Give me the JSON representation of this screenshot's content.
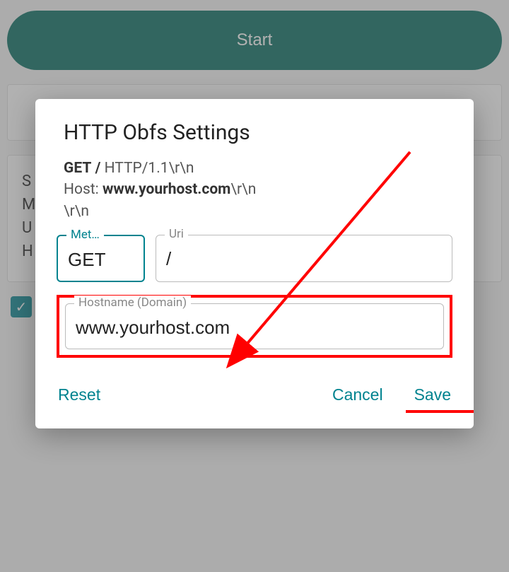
{
  "header": {
    "start_label": "Start"
  },
  "bg": {
    "line1": "S",
    "line2": "M",
    "line3": "U",
    "line4": "H"
  },
  "dialog": {
    "title": "HTTP Obfs Settings",
    "preview": {
      "method": "GET",
      "path": "/",
      "http_version": "HTTP/1.1",
      "crlf": "\\r\\n",
      "host_label": "Host:",
      "host_value": "www.yourhost.com"
    },
    "fields": {
      "method_label": "Met…",
      "method_value": "GET",
      "uri_label": "Uri",
      "uri_value": "/",
      "hostname_label": "Hostname (Domain)",
      "hostname_value": "www.yourhost.com"
    },
    "actions": {
      "reset": "Reset",
      "cancel": "Cancel",
      "save": "Save"
    }
  }
}
